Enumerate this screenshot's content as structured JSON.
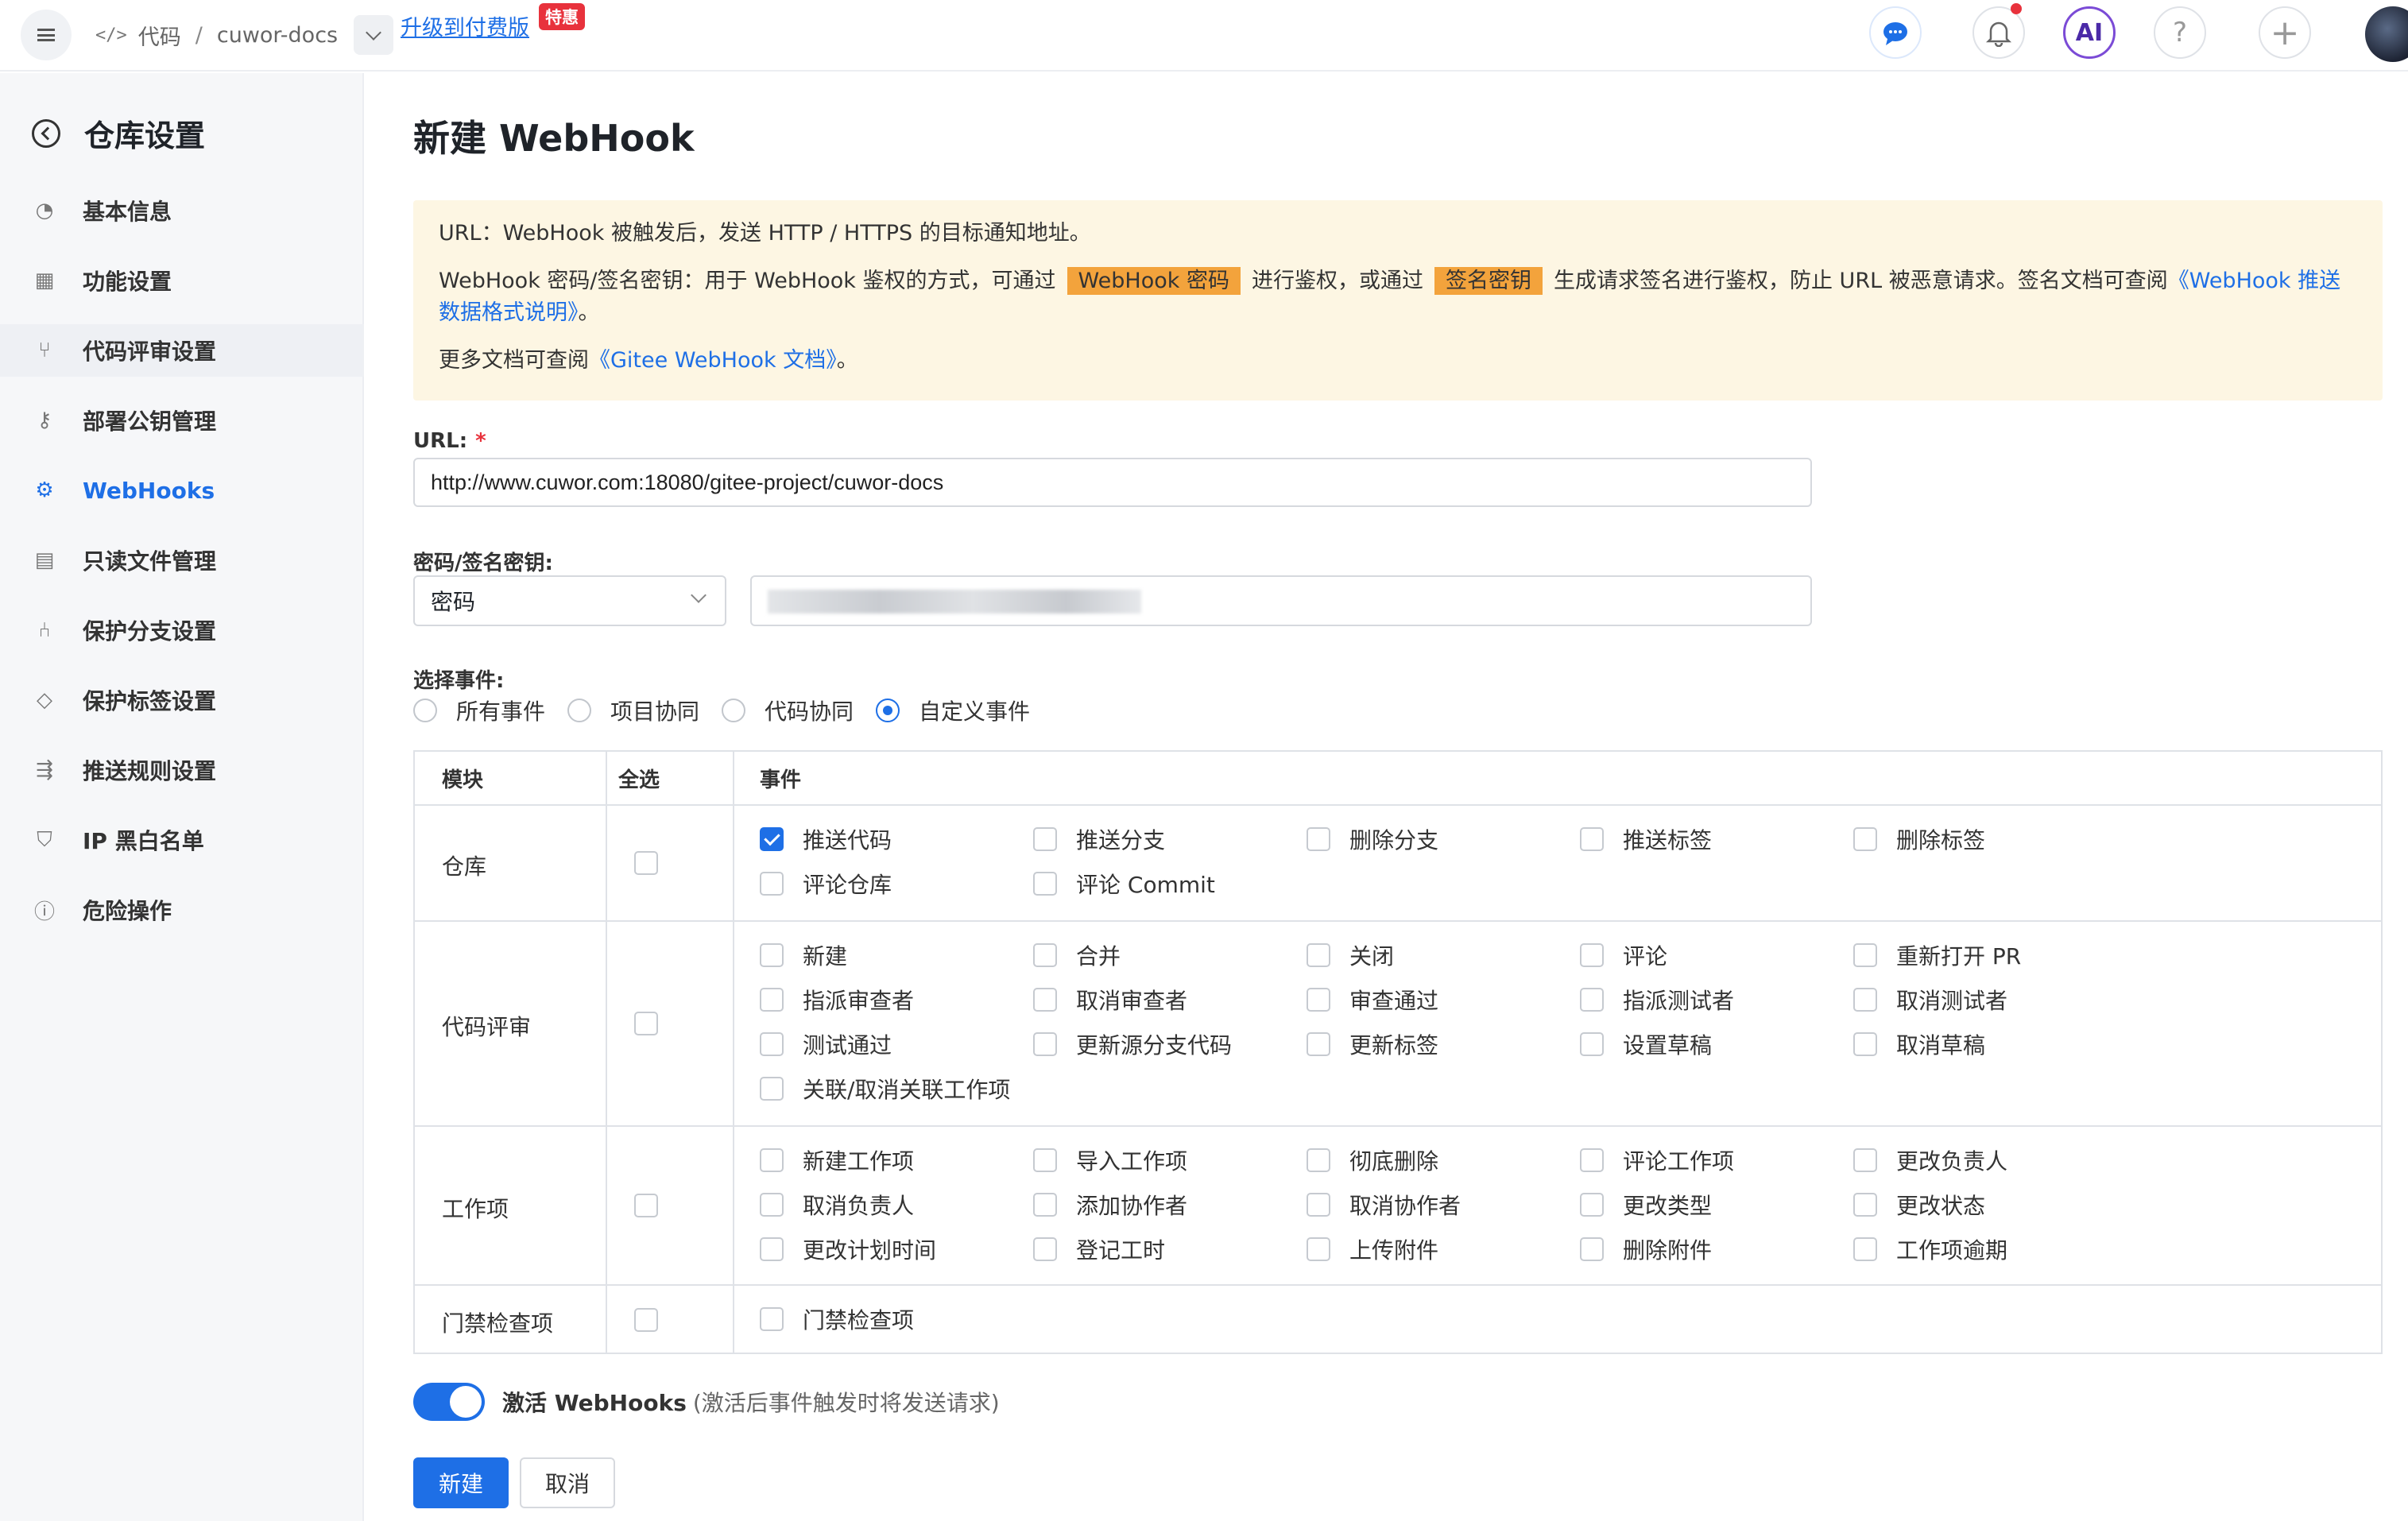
{
  "topbar": {
    "breadcrumb_code": "代码",
    "breadcrumb_sep": "/",
    "repo_name": "cuwor-docs",
    "upgrade_link": "升级到付费版",
    "upgrade_badge": "特惠",
    "ai_label": "AI",
    "help_label": "?",
    "plus_label": "+"
  },
  "sidebar": {
    "title": "仓库设置",
    "items": [
      {
        "label": "基本信息",
        "icon": "gauge-icon"
      },
      {
        "label": "功能设置",
        "icon": "grid-icon"
      },
      {
        "label": "代码评审设置",
        "icon": "pull-request-icon"
      },
      {
        "label": "部署公钥管理",
        "icon": "key-icon"
      },
      {
        "label": "WebHooks",
        "icon": "webhook-icon"
      },
      {
        "label": "只读文件管理",
        "icon": "file-icon"
      },
      {
        "label": "保护分支设置",
        "icon": "branch-icon"
      },
      {
        "label": "保护标签设置",
        "icon": "tag-icon"
      },
      {
        "label": "推送规则设置",
        "icon": "push-rule-icon"
      },
      {
        "label": "IP 黑白名单",
        "icon": "shield-icon"
      },
      {
        "label": "危险操作",
        "icon": "alert-icon"
      }
    ]
  },
  "page": {
    "title": "新建 WebHook",
    "notice": {
      "line1": "URL：WebHook 被触发后，发送 HTTP / HTTPS 的目标通知地址。",
      "line2_a": "WebHook 密码/签名密钥：用于 WebHook 鉴权的方式，可通过",
      "line2_tag1": "WebHook 密码",
      "line2_b": "进行鉴权，或通过",
      "line2_tag2": "签名密钥",
      "line2_c": "生成请求签名进行鉴权，防止 URL 被恶意请求。签名文档可查阅",
      "line2_link": "《WebHook 推送数据格式说明》",
      "line2_end": "。",
      "line3_a": "更多文档可查阅",
      "line3_link": "《Gitee WebHook 文档》",
      "line3_end": "。"
    },
    "url_label": "URL:",
    "url_required": "*",
    "url_value": "http://www.cuwor.com:18080/gitee-project/cuwor-docs",
    "secret_label": "密码/签名密钥:",
    "secret_type": "密码",
    "events_label": "选择事件:",
    "event_modes": [
      {
        "label": "所有事件",
        "selected": false
      },
      {
        "label": "项目协同",
        "selected": false
      },
      {
        "label": "代码协同",
        "selected": false
      },
      {
        "label": "自定义事件",
        "selected": true
      }
    ],
    "table": {
      "headers": {
        "module": "模块",
        "select_all": "全选",
        "events": "事件"
      },
      "rows": [
        {
          "module": "仓库",
          "events": [
            {
              "label": "推送代码",
              "checked": true
            },
            {
              "label": "推送分支",
              "checked": false
            },
            {
              "label": "删除分支",
              "checked": false
            },
            {
              "label": "推送标签",
              "checked": false
            },
            {
              "label": "删除标签",
              "checked": false
            },
            {
              "label": "评论仓库",
              "checked": false
            },
            {
              "label": "评论 Commit",
              "checked": false
            }
          ]
        },
        {
          "module": "代码评审",
          "events": [
            {
              "label": "新建",
              "checked": false
            },
            {
              "label": "合并",
              "checked": false
            },
            {
              "label": "关闭",
              "checked": false
            },
            {
              "label": "评论",
              "checked": false
            },
            {
              "label": "重新打开 PR",
              "checked": false
            },
            {
              "label": "指派审查者",
              "checked": false
            },
            {
              "label": "取消审查者",
              "checked": false
            },
            {
              "label": "审查通过",
              "checked": false
            },
            {
              "label": "指派测试者",
              "checked": false
            },
            {
              "label": "取消测试者",
              "checked": false
            },
            {
              "label": "测试通过",
              "checked": false
            },
            {
              "label": "更新源分支代码",
              "checked": false
            },
            {
              "label": "更新标签",
              "checked": false
            },
            {
              "label": "设置草稿",
              "checked": false
            },
            {
              "label": "取消草稿",
              "checked": false
            },
            {
              "label": "关联/取消关联工作项",
              "checked": false
            }
          ]
        },
        {
          "module": "工作项",
          "events": [
            {
              "label": "新建工作项",
              "checked": false
            },
            {
              "label": "导入工作项",
              "checked": false
            },
            {
              "label": "彻底删除",
              "checked": false
            },
            {
              "label": "评论工作项",
              "checked": false
            },
            {
              "label": "更改负责人",
              "checked": false
            },
            {
              "label": "取消负责人",
              "checked": false
            },
            {
              "label": "添加协作者",
              "checked": false
            },
            {
              "label": "取消协作者",
              "checked": false
            },
            {
              "label": "更改类型",
              "checked": false
            },
            {
              "label": "更改状态",
              "checked": false
            },
            {
              "label": "更改计划时间",
              "checked": false
            },
            {
              "label": "登记工时",
              "checked": false
            },
            {
              "label": "上传附件",
              "checked": false
            },
            {
              "label": "删除附件",
              "checked": false
            },
            {
              "label": "工作项逾期",
              "checked": false
            }
          ]
        },
        {
          "module": "门禁检查项",
          "events": [
            {
              "label": "门禁检查项",
              "checked": false
            }
          ]
        }
      ]
    },
    "activate_label": "激活 WebHooks",
    "activate_hint": "(激活后事件触发时将发送请求)",
    "activate_on": true,
    "create_button": "新建",
    "cancel_button": "取消"
  },
  "colors": {
    "accent": "#1e6fe6",
    "notice_bg": "#fdf6e3",
    "tag_bg": "#f3a33c",
    "badge": "#e8323c"
  }
}
